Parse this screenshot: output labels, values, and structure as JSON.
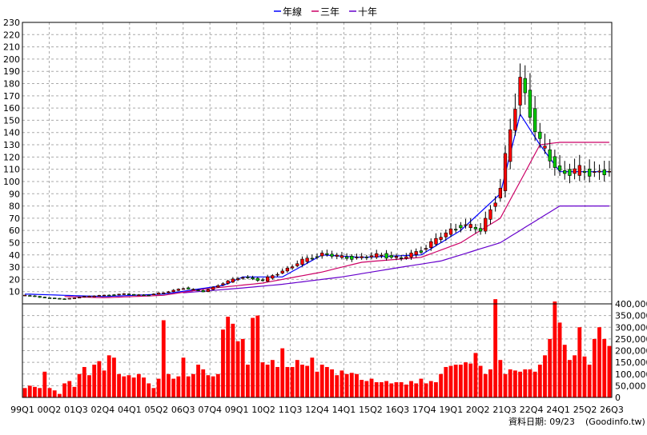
{
  "chart_data": [
    {
      "type": "candlestick",
      "legend": [
        "年線",
        "三年",
        "十年"
      ],
      "legend_placement": "top-center",
      "ylim": [
        0,
        230
      ],
      "yticks": [
        10,
        20,
        30,
        40,
        50,
        60,
        70,
        80,
        90,
        100,
        110,
        120,
        130,
        140,
        150,
        160,
        170,
        180,
        190,
        200,
        210,
        220,
        230
      ],
      "grid": true,
      "colors": {
        "up": "#ff0000",
        "down": "#00cc00",
        "year_line": "#0000ff",
        "three_year": "#cc0066",
        "ten_year": "#6600cc"
      },
      "annual_anchors": [
        [
          1999,
          7
        ],
        [
          2000,
          5
        ],
        [
          2001,
          4
        ],
        [
          2002,
          6
        ],
        [
          2003,
          7
        ],
        [
          2004,
          8
        ],
        [
          2005,
          7
        ],
        [
          2006,
          9
        ],
        [
          2007,
          13
        ],
        [
          2008,
          10
        ],
        [
          2009,
          17
        ],
        [
          2010,
          22
        ],
        [
          2011,
          19
        ],
        [
          2012,
          27
        ],
        [
          2013,
          35
        ],
        [
          2014,
          41
        ],
        [
          2015,
          38
        ],
        [
          2016,
          38
        ],
        [
          2017,
          40
        ],
        [
          2018,
          37
        ],
        [
          2019,
          44
        ],
        [
          2020,
          55
        ],
        [
          2021,
          65
        ],
        [
          2022,
          60
        ],
        [
          2023,
          95
        ],
        [
          2024,
          185
        ],
        [
          2025,
          130
        ],
        [
          2026,
          108
        ]
      ],
      "year_line_anchors": [
        [
          1999,
          8
        ],
        [
          2003,
          6
        ],
        [
          2006,
          8
        ],
        [
          2009,
          15
        ],
        [
          2010,
          22
        ],
        [
          2012,
          22
        ],
        [
          2014,
          40
        ],
        [
          2016,
          38
        ],
        [
          2019,
          40
        ],
        [
          2021,
          60
        ],
        [
          2023,
          90
        ],
        [
          2024,
          155
        ],
        [
          2025,
          130
        ],
        [
          2026,
          108
        ]
      ],
      "three_year_anchors": [
        [
          1999,
          7
        ],
        [
          2003,
          5
        ],
        [
          2006,
          7
        ],
        [
          2008,
          12
        ],
        [
          2011,
          17
        ],
        [
          2014,
          26
        ],
        [
          2016,
          34
        ],
        [
          2019,
          38
        ],
        [
          2021,
          50
        ],
        [
          2023,
          70
        ],
        [
          2024,
          100
        ],
        [
          2025,
          130
        ],
        [
          2026,
          132
        ]
      ],
      "ten_year_anchors": [
        [
          2007,
          9
        ],
        [
          2010,
          13
        ],
        [
          2012,
          16
        ],
        [
          2015,
          22
        ],
        [
          2018,
          30
        ],
        [
          2020,
          35
        ],
        [
          2022,
          45
        ],
        [
          2023,
          50
        ],
        [
          2024,
          60
        ],
        [
          2025,
          70
        ],
        [
          2026,
          80
        ]
      ]
    },
    {
      "type": "bar",
      "ylim": [
        0,
        400000
      ],
      "yticks": [
        0,
        50000,
        100000,
        150000,
        200000,
        250000,
        300000,
        350000,
        400000
      ],
      "ytick_labels": [
        "0",
        "50,000",
        "100,000",
        "150,000",
        "200,000",
        "250,000",
        "300,000",
        "350,000",
        "400,000"
      ],
      "x_tick_labels": [
        "99Q1",
        "00Q2",
        "01Q3",
        "02Q4",
        "04Q1",
        "05Q2",
        "06Q3",
        "07Q4",
        "09Q1",
        "10Q2",
        "11Q3",
        "12Q4",
        "14Q1",
        "15Q2",
        "16Q3",
        "17Q4",
        "19Q1",
        "20Q2",
        "21Q3",
        "22Q4",
        "24Q1",
        "25Q2",
        "26Q3"
      ],
      "color": "#ff0000",
      "values": [
        40000,
        50000,
        45000,
        40000,
        110000,
        40000,
        30000,
        15000,
        60000,
        70000,
        45000,
        100000,
        130000,
        95000,
        140000,
        155000,
        115000,
        180000,
        170000,
        100000,
        90000,
        95000,
        85000,
        100000,
        85000,
        60000,
        40000,
        80000,
        330000,
        100000,
        80000,
        90000,
        170000,
        90000,
        100000,
        140000,
        120000,
        95000,
        90000,
        100000,
        290000,
        345000,
        315000,
        240000,
        250000,
        140000,
        340000,
        350000,
        150000,
        140000,
        160000,
        130000,
        210000,
        130000,
        130000,
        160000,
        140000,
        135000,
        170000,
        110000,
        140000,
        130000,
        120000,
        95000,
        115000,
        100000,
        105000,
        100000,
        75000,
        70000,
        80000,
        65000,
        65000,
        70000,
        60000,
        65000,
        65000,
        55000,
        70000,
        60000,
        80000,
        60000,
        70000,
        65000,
        100000,
        130000,
        135000,
        140000,
        140000,
        150000,
        145000,
        190000,
        135000,
        100000,
        120000,
        420000,
        160000,
        100000,
        120000,
        115000,
        110000,
        120000,
        120000,
        110000,
        140000,
        180000,
        250000,
        410000,
        320000,
        225000,
        160000,
        180000,
        300000,
        175000,
        140000,
        250000,
        300000,
        250000,
        220000
      ]
    }
  ],
  "date_label": "資料日期: 09/23",
  "source": "(Goodinfo.tw)"
}
